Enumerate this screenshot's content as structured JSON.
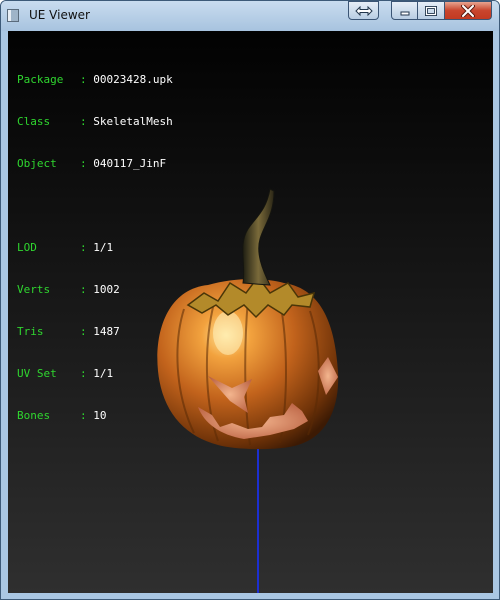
{
  "window": {
    "title": "UE Viewer"
  },
  "caption_buttons": {
    "resize": "resize-arrows-icon",
    "minimize": "minimize-icon",
    "maximize": "maximize-icon",
    "close": "close-icon"
  },
  "info": {
    "package": {
      "label": "Package",
      "value": "00023428.upk"
    },
    "class": {
      "label": "Class",
      "value": "SkeletalMesh"
    },
    "object": {
      "label": "Object",
      "value": "040117_JinF"
    },
    "lod": {
      "label": "LOD",
      "value": "1/1"
    },
    "verts": {
      "label": "Verts",
      "value": "1002"
    },
    "tris": {
      "label": "Tris",
      "value": "1487"
    },
    "uvset": {
      "label": "UV Set",
      "value": "1/1"
    },
    "bones": {
      "label": "Bones",
      "value": "10"
    }
  },
  "colors": {
    "label_green": "#2fd62f",
    "value_white": "#ffffff",
    "bone_line": "#1c2fd0",
    "pumpkin": "#d9822b"
  }
}
